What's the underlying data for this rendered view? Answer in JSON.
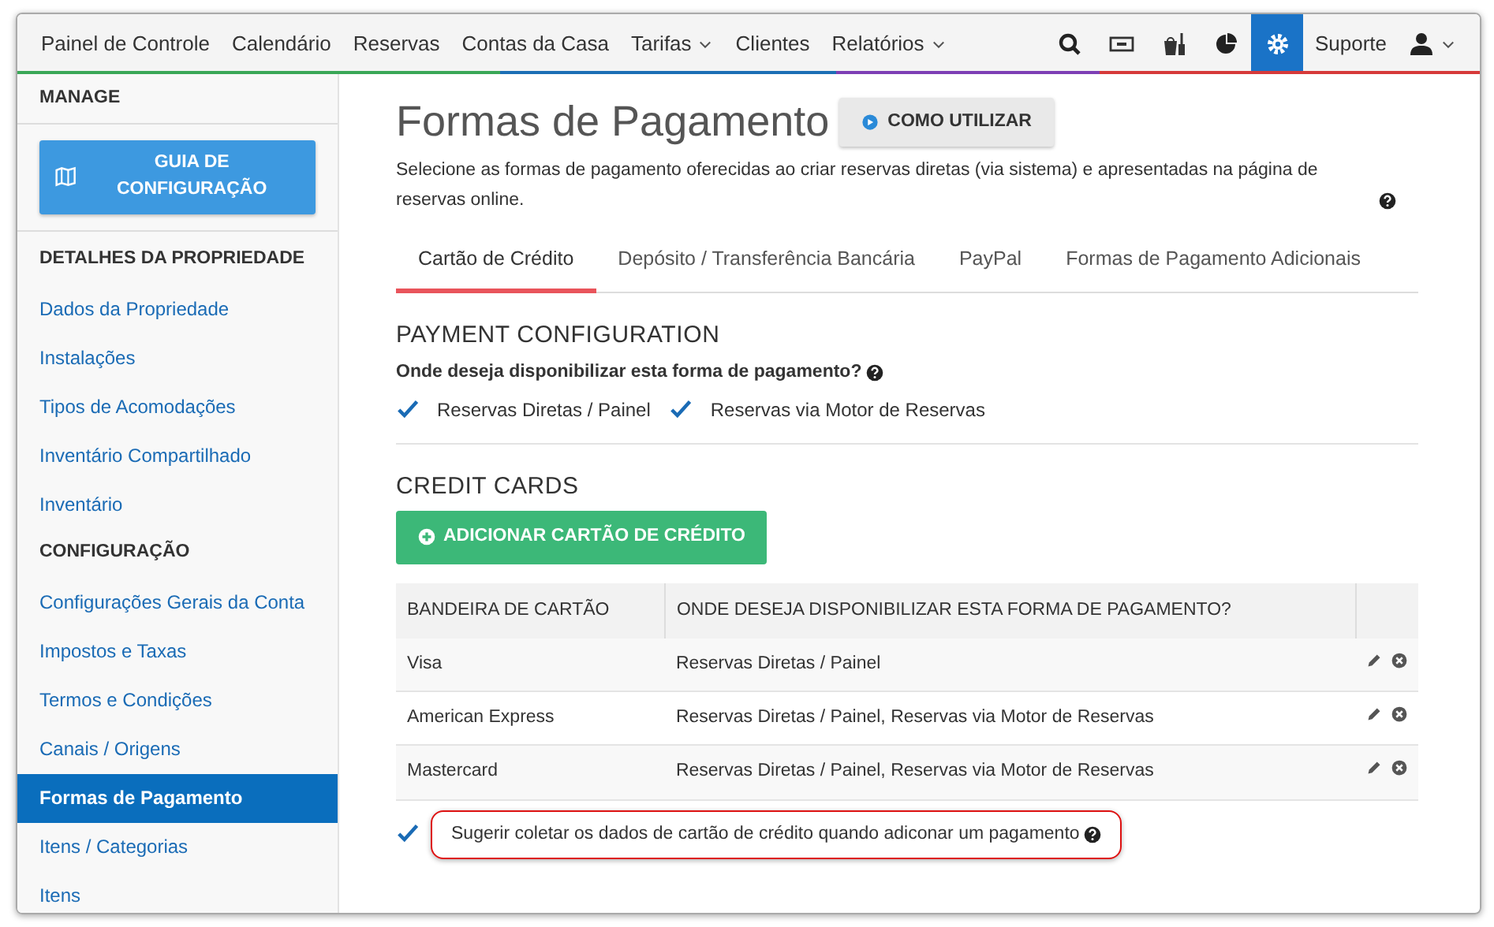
{
  "navbar": {
    "items": [
      {
        "label": "Painel de Controle",
        "dropdown": false
      },
      {
        "label": "Calendário",
        "dropdown": false
      },
      {
        "label": "Reservas",
        "dropdown": false
      },
      {
        "label": "Contas da Casa",
        "dropdown": false
      },
      {
        "label": "Tarifas",
        "dropdown": true
      },
      {
        "label": "Clientes",
        "dropdown": false
      },
      {
        "label": "Relatórios",
        "dropdown": true
      }
    ],
    "tools": [
      {
        "kind": "search",
        "selected": false
      },
      {
        "kind": "ticket",
        "selected": false
      },
      {
        "kind": "housekeeping",
        "selected": false
      },
      {
        "kind": "chart",
        "selected": false
      },
      {
        "kind": "settings",
        "selected": true
      }
    ],
    "support": "Suporte"
  },
  "sidebar": {
    "items": [
      {
        "kind": "header",
        "label": "MANAGE"
      },
      {
        "kind": "button",
        "label": "GUIA DE CONFIGURAÇÃO"
      },
      {
        "kind": "header",
        "label": "DETALHES DA PROPRIEDADE"
      },
      {
        "kind": "link",
        "label": "Dados da Propriedade",
        "selected": false
      },
      {
        "kind": "link",
        "label": "Instalações",
        "selected": false
      },
      {
        "kind": "link",
        "label": "Tipos de Acomodações",
        "selected": false
      },
      {
        "kind": "link",
        "label": "Inventário Compartilhado",
        "selected": false
      },
      {
        "kind": "link",
        "label": "Inventário",
        "selected": false
      },
      {
        "kind": "header",
        "label": "CONFIGURAÇÃO"
      },
      {
        "kind": "link",
        "label": "Configurações Gerais da Conta",
        "selected": false
      },
      {
        "kind": "link",
        "label": "Impostos e Taxas",
        "selected": false
      },
      {
        "kind": "link",
        "label": "Termos e Condições",
        "selected": false
      },
      {
        "kind": "link",
        "label": "Canais / Origens",
        "selected": false
      },
      {
        "kind": "link",
        "label": "Formas de Pagamento",
        "selected": true
      },
      {
        "kind": "link",
        "label": "Itens / Categorias",
        "selected": false
      },
      {
        "kind": "link",
        "label": "Itens",
        "selected": false
      }
    ]
  },
  "page": {
    "title": "Formas de Pagamento",
    "help_button": "COMO UTILIZAR",
    "description": "Selecione as formas de pagamento oferecidas ao criar reservas diretas (via sistema) e apresentadas na página de reservas online.",
    "tabs": [
      {
        "label": "Cartão de Crédito",
        "selected": true
      },
      {
        "label": "Depósito / Transferência Bancária",
        "selected": false
      },
      {
        "label": "PayPal",
        "selected": false
      },
      {
        "label": "Formas de Pagamento Adicionais",
        "selected": false
      }
    ],
    "payment_configuration": {
      "heading": "PAYMENT CONFIGURATION",
      "question": "Onde deseja disponibilizar esta forma de pagamento?",
      "options": [
        {
          "label": "Reservas Diretas / Painel",
          "checked": true
        },
        {
          "label": "Reservas via Motor de Reservas",
          "checked": true
        }
      ]
    },
    "credit_cards": {
      "heading": "CREDIT CARDS",
      "add_button": "ADICIONAR CARTÃO DE CRÉDITO",
      "table": {
        "columns": [
          "BANDEIRA DE CARTÃO",
          "ONDE DESEJA DISPONIBILIZAR ESTA FORMA DE PAGAMENTO?"
        ],
        "rows": [
          [
            "Visa",
            "Reservas Diretas / Painel"
          ],
          [
            "American Express",
            "Reservas Diretas / Painel, Reservas via Motor de Reservas"
          ],
          [
            "Mastercard",
            "Reservas Diretas / Painel, Reservas via Motor de Reservas"
          ]
        ]
      },
      "suggest_option": {
        "label": "Sugerir coletar os dados de cartão de crédito quando adiconar um pagamento",
        "checked": true,
        "highlighted": true
      }
    }
  }
}
